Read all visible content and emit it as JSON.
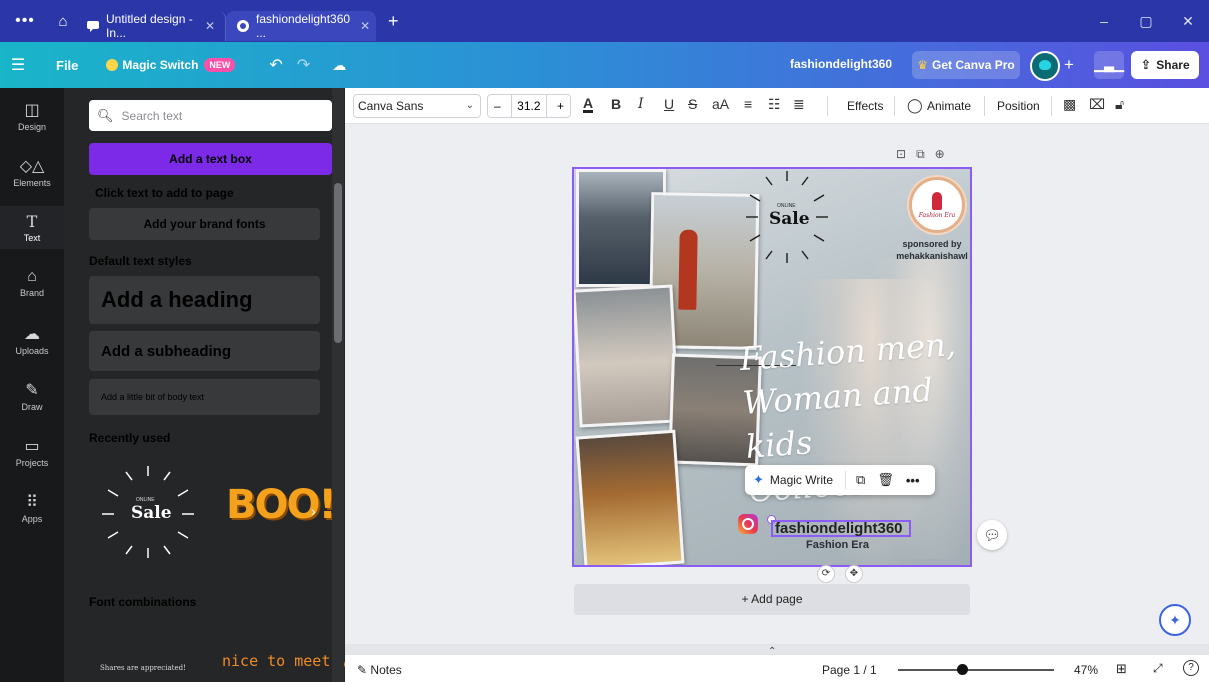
{
  "browser": {
    "tabs": [
      {
        "label": "Untitled design - In...",
        "active": false
      },
      {
        "label": "fashiondelight360 ...",
        "active": true
      }
    ]
  },
  "topbar": {
    "file_label": "File",
    "magic_switch_label": "Magic Switch",
    "new_badge": "NEW",
    "doc_name": "fashiondelight360",
    "get_pro_label": "Get Canva Pro",
    "share_label": "Share"
  },
  "rail": {
    "items": [
      {
        "label": "Design",
        "icon": "layout-icon"
      },
      {
        "label": "Elements",
        "icon": "shapes-icon"
      },
      {
        "label": "Text",
        "icon": "text-icon"
      },
      {
        "label": "Brand",
        "icon": "brand-icon"
      },
      {
        "label": "Uploads",
        "icon": "upload-cloud-icon"
      },
      {
        "label": "Draw",
        "icon": "pen-icon"
      },
      {
        "label": "Projects",
        "icon": "folder-icon"
      },
      {
        "label": "Apps",
        "icon": "apps-grid-icon"
      }
    ]
  },
  "panel": {
    "search_placeholder": "Search text",
    "add_text_box": "Add a text box",
    "click_hint": "Click text to add to page",
    "brand_fonts": "Add your brand fonts",
    "default_styles_title": "Default text styles",
    "heading": "Add a heading",
    "subheading": "Add a subheading",
    "body": "Add a little bit of body text",
    "recently_used_title": "Recently used",
    "recent_boo": "BOO!",
    "font_combinations_title": "Font combinations",
    "combo1": "Shares are appreciated!",
    "combo2": "nice to meet you!"
  },
  "toolbar": {
    "font": "Canva Sans",
    "font_size": "31.2",
    "effects": "Effects",
    "animate": "Animate",
    "position": "Position"
  },
  "design": {
    "sale_small": "ONLINE",
    "sale_big": "Sale",
    "sponsor_line1": "sponsored by",
    "sponsor_line2": "mehakkanishawl",
    "logo_text": "Fashion Era",
    "script_text": "Fashion men, Woman and kids Collection",
    "handle": "fashiondelight360",
    "brand": "Fashion Era"
  },
  "popup": {
    "magic_write": "Magic Write"
  },
  "canvas": {
    "add_page": "+ Add page"
  },
  "status": {
    "notes": "Notes",
    "page": "Page 1 / 1",
    "zoom": "47%",
    "zoom_level": 0.47
  },
  "colors": {
    "accent": "#7d2ae8",
    "selection": "#8b5cf6",
    "tabbar": "#2b37a8"
  }
}
